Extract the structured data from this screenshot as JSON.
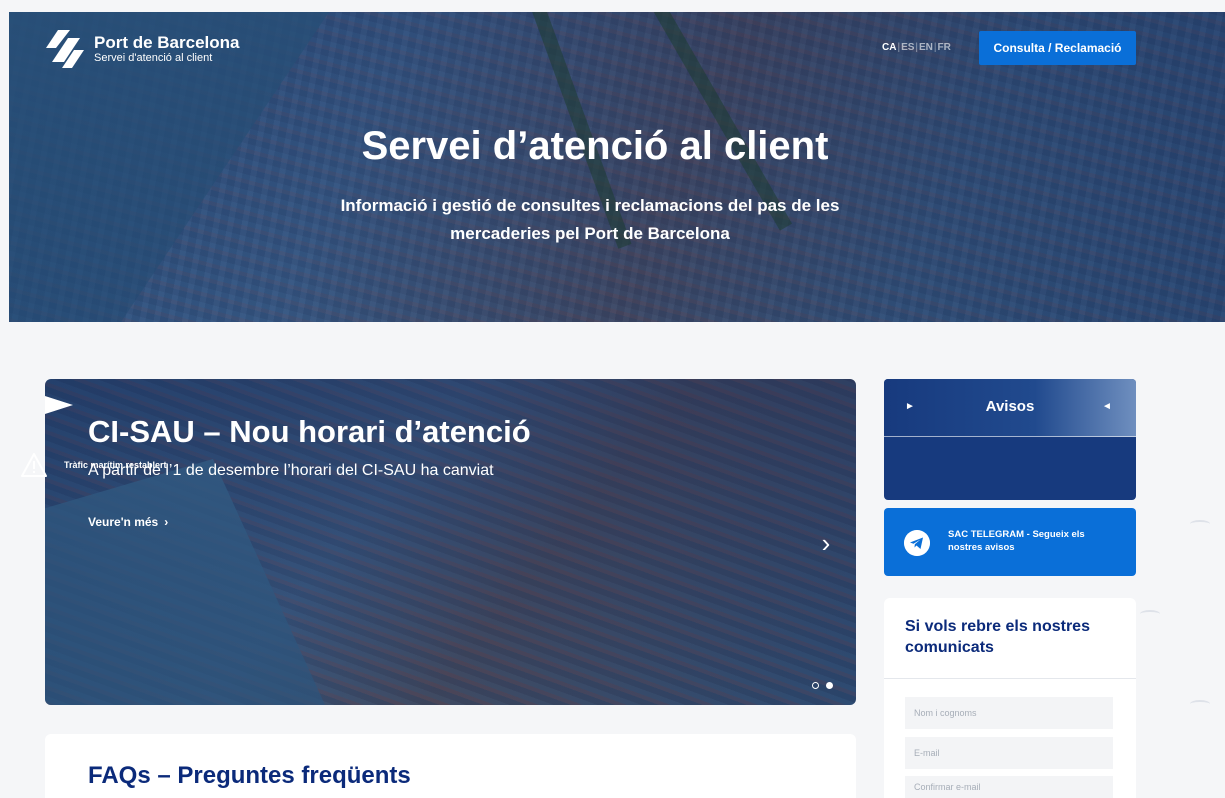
{
  "header": {
    "logo_title": "Port de Barcelona",
    "logo_subtitle": "Servei d'atenció al client",
    "languages": [
      "CA",
      "ES",
      "EN",
      "FR"
    ],
    "active_language": "CA",
    "cta_label": "Consulta / Reclamació"
  },
  "hero": {
    "title": "Servei d’atenció al client",
    "subtitle": "Informació i gestió de consultes i reclamacions del pas de les mercaderies pel Port de Barcelona"
  },
  "carousel": {
    "title": "CI-SAU – Nou horari d’atenció",
    "subtitle": "A partir de l’1 de desembre l’horari del CI-SAU ha canviat",
    "more_label": "Veure'n més",
    "slide_count": 2,
    "active_slide": 2
  },
  "faq": {
    "title": "FAQs – Preguntes freqüents"
  },
  "avisos": {
    "title": "Avisos",
    "items": [
      {
        "text": "Tràfic marítim restablert",
        "icon": "warning-icon"
      }
    ]
  },
  "telegram": {
    "text": "SAC TELEGRAM - Segueix els nostres avisos",
    "icon": "telegram-icon"
  },
  "newsletter": {
    "title": "Si vols rebre els nostres comunicats",
    "fields": [
      {
        "placeholder": "Nom i cognoms"
      },
      {
        "placeholder": "E-mail"
      },
      {
        "placeholder": "Confirmar e-mail"
      }
    ]
  },
  "colors": {
    "primary_blue": "#0a6fd8",
    "navy": "#0b2a7a",
    "avisos_bg": "#173a7e"
  }
}
